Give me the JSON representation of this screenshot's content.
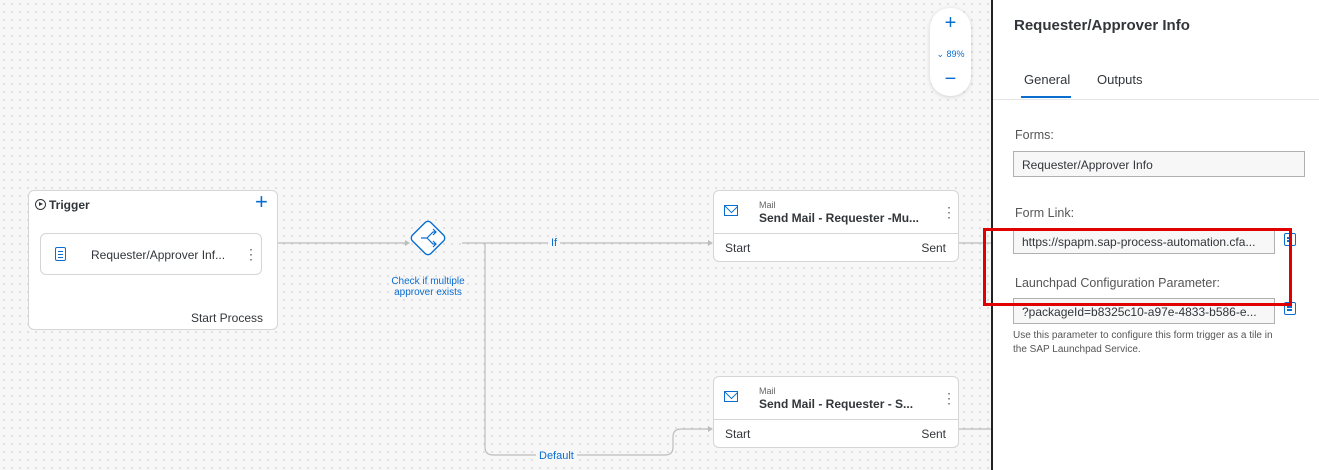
{
  "canvas": {
    "zoom": {
      "plus": "+",
      "level": "89%",
      "minus": "−"
    },
    "trigger": {
      "title": "Trigger",
      "add_icon": "+",
      "form_label": "Requester/Approver Inf...",
      "start_label": "Start Process"
    },
    "gateway": {
      "label_line1": "Check if multiple",
      "label_line2": "approver exists"
    },
    "edges": {
      "if_label": "If",
      "default_label": "Default"
    },
    "mail1": {
      "type": "Mail",
      "title": "Send Mail - Requester -Mu...",
      "start": "Start",
      "sent": "Sent"
    },
    "mail2": {
      "type": "Mail",
      "title": "Send Mail - Requester - S...",
      "start": "Start",
      "sent": "Sent"
    }
  },
  "panel": {
    "title": "Requester/Approver Info",
    "tabs": [
      {
        "label": "General",
        "active": true
      },
      {
        "label": "Outputs",
        "active": false
      }
    ],
    "forms_label": "Forms:",
    "forms_value": "Requester/Approver Info",
    "form_link_label": "Form Link:",
    "form_link_value": "https://spapm.sap-process-automation.cfa...",
    "launchpad_label": "Launchpad Configuration Parameter:",
    "launchpad_value": "?packageId=b8325c10-a97e-4833-b586-e...",
    "help_line1": "Use this parameter to configure this form trigger as a tile in",
    "help_line2": "the SAP Launchpad Service."
  },
  "colors": {
    "accent": "#0a6ed1",
    "highlight": "#e10000"
  }
}
